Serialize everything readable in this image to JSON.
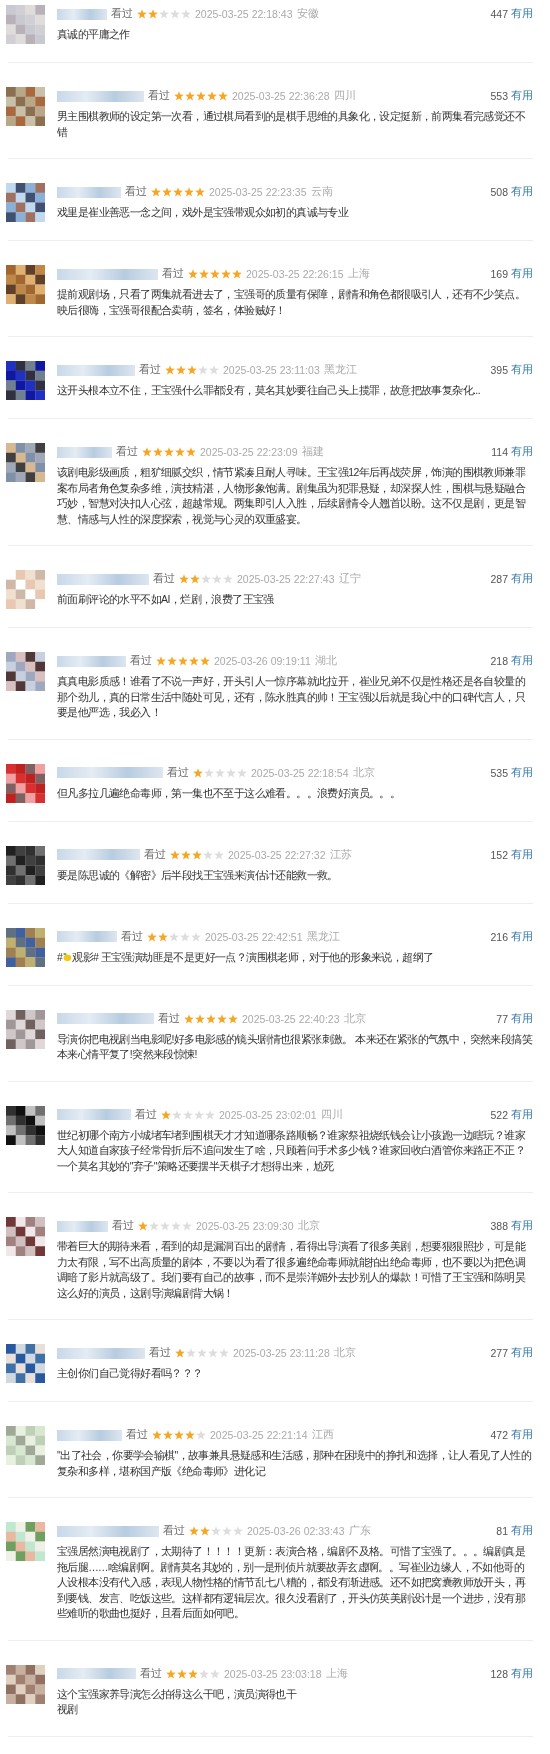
{
  "reviews": [
    {
      "status": "看过",
      "stars": 2,
      "time": "2025-03-25 22:18:43",
      "location": "安徽",
      "votes": "447",
      "vote_label": "有用",
      "comment": "真诚的平庸之作"
    },
    {
      "status": "看过",
      "stars": 5,
      "time": "2025-03-25 22:36:28",
      "location": "四川",
      "votes": "553",
      "vote_label": "有用",
      "comment": "男主围棋教师的设定第一次看，通过棋局看到的是棋手思维的具象化，设定挺新，前两集看完感觉还不错"
    },
    {
      "status": "看过",
      "stars": 5,
      "time": "2025-03-25 22:23:35",
      "location": "云南",
      "votes": "508",
      "vote_label": "有用",
      "comment": "戏里是崔业善恶一念之间，戏外是宝强带观众如初的真诚与专业"
    },
    {
      "status": "看过",
      "stars": 5,
      "time": "2025-03-25 22:26:15",
      "location": "上海",
      "votes": "169",
      "vote_label": "有用",
      "comment": "提前观剧场，只看了两集就看进去了，宝强哥的质量有保障，剧情和角色都很吸引人，还有不少笑点。映后很嗨，宝强哥很配合卖萌，签名，体验贼好！"
    },
    {
      "status": "看过",
      "stars": 3,
      "time": "2025-03-25 23:11:03",
      "location": "黑龙江",
      "votes": "395",
      "vote_label": "有用",
      "comment": "这开头根本立不住，王宝强什么罪都没有，莫名其妙要往自己头上揽罪，故意把故事复杂化..."
    },
    {
      "status": "看过",
      "stars": 5,
      "time": "2025-03-25 22:23:09",
      "location": "福建",
      "votes": "114",
      "vote_label": "有用",
      "comment": "该剧电影级画质，粗犷细腻交织，情节紧凑且耐人寻味。王宝强12年后再战荧屏，饰演的围棋教师兼罪案布局者角色复杂多维，演技精湛，人物形象饱满。剧集虽为犯罪悬疑，却深探人性，围棋与悬疑融合巧妙，智慧对决扣人心弦，超越常规。两集即引人入胜，后续剧情令人翘首以盼。这不仅是剧，更是智慧、情感与人性的深度探索，视觉与心灵的双重盛宴。"
    },
    {
      "status": "看过",
      "stars": 2,
      "time": "2025-03-25 22:27:43",
      "location": "辽宁",
      "votes": "287",
      "vote_label": "有用",
      "comment": "前面刷评论的水平不如AI，烂剧，浪费了王宝强"
    },
    {
      "status": "看过",
      "stars": 5,
      "time": "2025-03-26 09:19:11",
      "location": "湖北",
      "votes": "218",
      "vote_label": "有用",
      "comment": "真真电影质感！谁看了不说一声好，开头引人一惊序幕就此拉开，崔业兄弟不仅是性格还是各自较量的那个劲儿，真的日常生活中随处可见，还有，陈永胜真的帅！王宝强以后就是我心中的口碑代言人，只要是他严选，我必入！"
    },
    {
      "status": "看过",
      "stars": 1,
      "time": "2025-03-25 22:18:54",
      "location": "北京",
      "votes": "535",
      "vote_label": "有用",
      "comment": "但凡多拉几遍绝命毒师，第一集也不至于这么难看。。。浪费好演员。。。"
    },
    {
      "status": "看过",
      "stars": 3,
      "time": "2025-03-25 22:27:32",
      "location": "江苏",
      "votes": "152",
      "vote_label": "有用",
      "comment": "要是陈思诚的《解密》后半段找王宝强来演估计还能救一救。"
    },
    {
      "status": "看过",
      "stars": 2,
      "time": "2025-03-25 22:42:51",
      "location": "黑龙江",
      "votes": "216",
      "vote_label": "有用",
      "comment_parts": [
        "#",
        "观影# 王宝强演劫匪是不是更好一点？演围棋老师，对于他的形象来说，超纲了"
      ]
    },
    {
      "status": "看过",
      "stars": 5,
      "time": "2025-03-25 22:40:23",
      "location": "北京",
      "votes": "77",
      "vote_label": "有用",
      "comment": "导演你把电视剧当电影呢!好多电影感的镜头!剧情也很紧张刺激。 本来还在紧张的气氛中，突然来段搞笑本来心情平复了!突然来段惊悚!"
    },
    {
      "status": "看过",
      "stars": 1,
      "time": "2025-03-25 23:02:01",
      "location": "四川",
      "votes": "522",
      "vote_label": "有用",
      "comment": "世纪初哪个南方小城堵车堵到围棋天才才知道哪条路顺畅？谁家祭祖烧纸钱会让小孩跑一边瞎玩？谁家大人知道自家孩子经常骨折后不追问发生了啥，只顾着问手术多少钱？谁家回收白酒管你来路正不正？一个莫名其妙的\"弃子\"策略还要摆半天棋子才想得出来，尬死"
    },
    {
      "status": "看过",
      "stars": 1,
      "time": "2025-03-25 23:09:30",
      "location": "北京",
      "votes": "388",
      "vote_label": "有用",
      "comment": "带着巨大的期待来看，看到的却是漏洞百出的剧情，看得出导演看了很多美剧，想要狠狠照抄，可是能力太有限，写不出高质量的剧本，不要以为看了很多遍绝命毒师就能拍出绝命毒师，也不要以为把色调调暗了影片就高级了。我们要有自己的故事，而不是崇洋媚外去抄别人的爆款！可惜了王宝强和陈明昊这么好的演员，这剧导演编剧背大锅！"
    },
    {
      "status": "看过",
      "stars": 1,
      "time": "2025-03-25 23:11:28",
      "location": "北京",
      "votes": "277",
      "vote_label": "有用",
      "comment": "主创你们自己觉得好看吗？？？"
    },
    {
      "status": "看过",
      "stars": 4,
      "time": "2025-03-25 22:21:14",
      "location": "江西",
      "votes": "472",
      "vote_label": "有用",
      "comment": "\"出了社会，你要学会输棋\"，故事兼具悬疑感和生活感，那种在困境中的挣扎和选择，让人看见了人性的复杂和多样，堪称国产版《绝命毒师》进化记"
    },
    {
      "status": "看过",
      "stars": 2,
      "time": "2025-03-26 02:33:43",
      "location": "广东",
      "votes": "81",
      "vote_label": "有用",
      "comment": "宝强居然演电视剧了，太期待了！！！！更新：表演合格，编剧不及格。可惜了宝强了。。。编剧真是拖后腿……啥编剧啊。剧情莫名其妙的，别一是刑侦片就要故弄玄虚啊。。写崔业边缘人，不如他哥的人设根本没有代入感，表现人物性格的情节乱七八糟的，都没有渐进感。还不如把窝囊教师放开头，再到要钱、发言、吃饭这些。这样都有逻辑层次。很久没看剧了，开头仿英美剧设计是一个进步，没有那些难听的歌曲也挺好，且看后面如何吧。"
    },
    {
      "status": "看过",
      "stars": 3,
      "time": "2025-03-25 23:03:18",
      "location": "上海",
      "votes": "128",
      "vote_label": "有用",
      "comment": "这个宝强家养导演怎么拍得这么干吧，演员演得也干",
      "comment_more": "视剧"
    }
  ]
}
